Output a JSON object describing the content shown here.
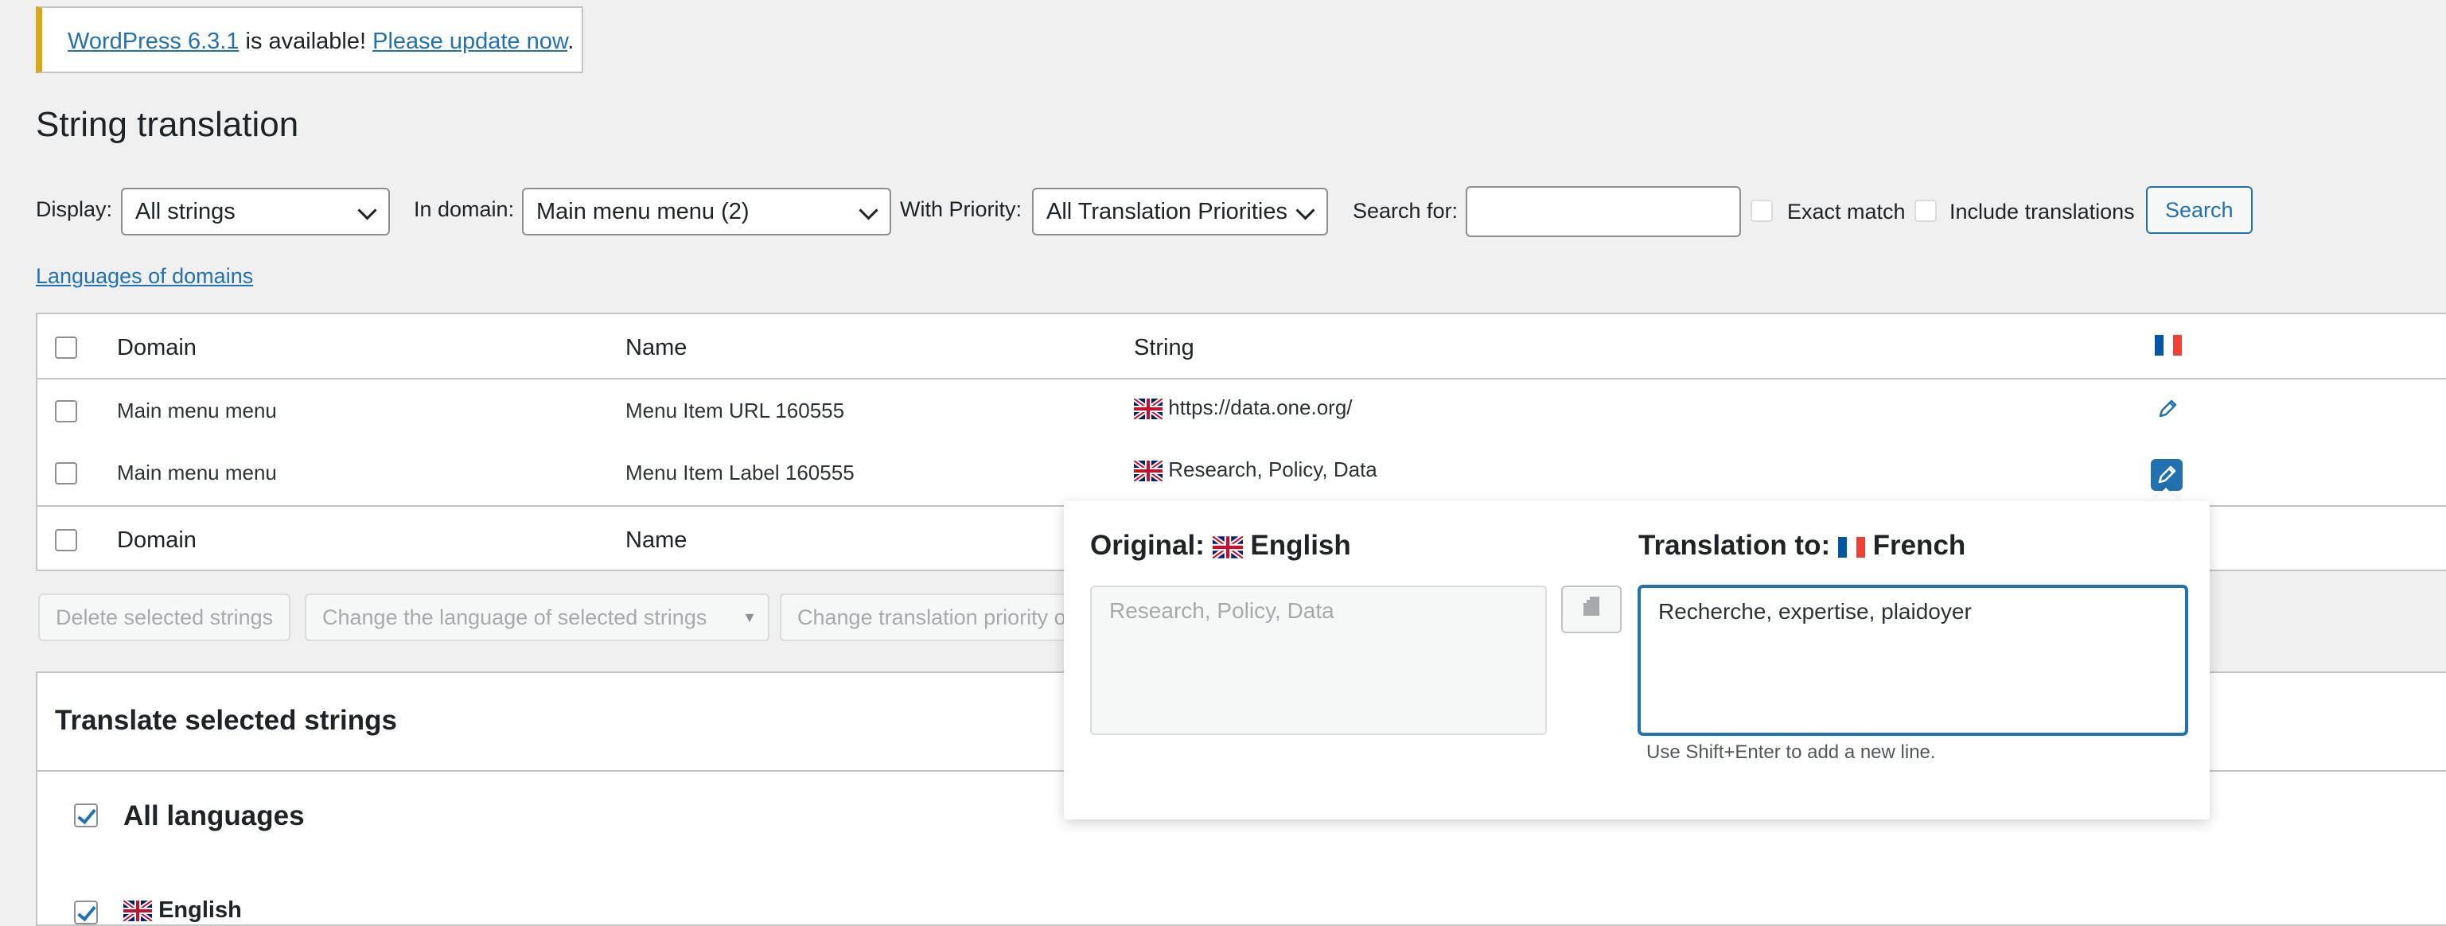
{
  "notice": {
    "version_link": "WordPress 6.3.1",
    "middle_text": " is available! ",
    "update_link": "Please update now",
    "end_text": "."
  },
  "page_title": "String translation",
  "filters": {
    "display_label": "Display:",
    "display_value": "All strings",
    "domain_label": "In domain:",
    "domain_value": "Main menu menu (2)",
    "priority_label": "With Priority:",
    "priority_value": "All Translation Priorities",
    "search_label": "Search for:",
    "search_value": "",
    "exact_match_label": "Exact match",
    "include_translations_label": "Include translations",
    "search_button": "Search"
  },
  "languages_link": "Languages of domains",
  "table": {
    "headers": {
      "domain": "Domain",
      "name": "Name",
      "string": "String"
    },
    "rows": [
      {
        "domain": "Main menu menu",
        "name": "Menu Item URL 160555",
        "string": "https://data.one.org/"
      },
      {
        "domain": "Main menu menu",
        "name": "Menu Item Label 160555",
        "string": "Research, Policy, Data"
      }
    ],
    "footer": {
      "domain": "Domain",
      "name": "Name"
    }
  },
  "bulk_actions": {
    "delete": "Delete selected strings",
    "change_language": "Change the language of selected strings",
    "change_priority": "Change translation priority of selected strings"
  },
  "translate_box": {
    "title": "Translate selected strings",
    "all_languages": "All languages",
    "english": "English"
  },
  "popup": {
    "original_label": "Original:",
    "original_language": "English",
    "original_text": "Research, Policy, Data",
    "translation_label": "Translation to:",
    "translation_language": "French",
    "translation_text": "Recherche, expertise, plaidoyer",
    "hint": "Use Shift+Enter to add a new line."
  },
  "colors": {
    "accent": "#2271b1",
    "notice_border": "#dba617",
    "background": "#f0f0f1"
  },
  "icons": {
    "edit": "pencil-icon",
    "copy": "copy-icon",
    "french_flag": "french-flag-icon",
    "uk_flag": "uk-flag-icon",
    "dropdown": "chevron-down-icon"
  }
}
